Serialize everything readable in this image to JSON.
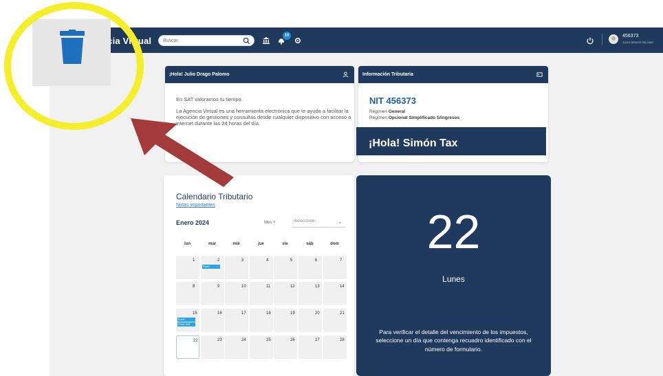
{
  "colors": {
    "navy": "#1f3a5c",
    "accent_blue": "#2ba5e8",
    "highlight_yellow": "#f5ee2a",
    "arrow_red": "#a33b3a"
  },
  "header": {
    "app_title": "ncia Virtual",
    "search_placeholder": "Buscar",
    "notification_count": "10",
    "user_id": "456373",
    "user_name": "JULIO DRAGO PALOMO",
    "icons": [
      "search-icon",
      "bank-icon",
      "notification-icon",
      "settings-icon",
      "power-icon",
      "avatar"
    ]
  },
  "welcome_card": {
    "title": "¡Hola! Julio Drago Palomo",
    "line1": "En SAT valoramos tu tiempo.",
    "line2": "La Agencia Virtual es una herramienta electrónica que te ayuda a facilitar la ejecución de gestiones y consultas desde cualquier dispositivo con acceso a internet durante las 24 horas del día."
  },
  "tax_card": {
    "title": "Información Tributaria",
    "nit": "NIT 456373",
    "regime_label": "Régimen",
    "regime_value": "General",
    "regime2_value": "Opcional Simplificado S/ingresos"
  },
  "chatbot_banner": "¡Hola! Simón Tax",
  "calendar": {
    "title": "Calendario Tributario",
    "notes_link": "Notas importantes",
    "month": "Enero 2024",
    "view": "Mes",
    "select_placeholder": "-Seleccione-",
    "weekdays": [
      "lun",
      "mar",
      "mié",
      "jue",
      "vie",
      "sáb",
      "dom"
    ],
    "weeks": [
      [
        "1",
        "2",
        "3",
        "4",
        "5",
        "6",
        "7"
      ],
      [
        "8",
        "9",
        "10",
        "11",
        "12",
        "13",
        "14"
      ],
      [
        "15",
        "16",
        "17",
        "18",
        "19",
        "20",
        "21"
      ],
      [
        "22",
        "23",
        "24",
        "25",
        "26",
        "27",
        "28"
      ]
    ],
    "events": {
      "2": [
        "Form"
      ],
      "15": [
        "Form",
        "Form SAT"
      ]
    }
  },
  "day_panel": {
    "day": "22",
    "weekday": "Lunes",
    "note": "Para verificar el detalle del vencimiento de los impuestos, seleccione un día que contenga recuadro identificado con el número de formulario."
  },
  "annotation": {
    "icon": "trash-icon"
  }
}
